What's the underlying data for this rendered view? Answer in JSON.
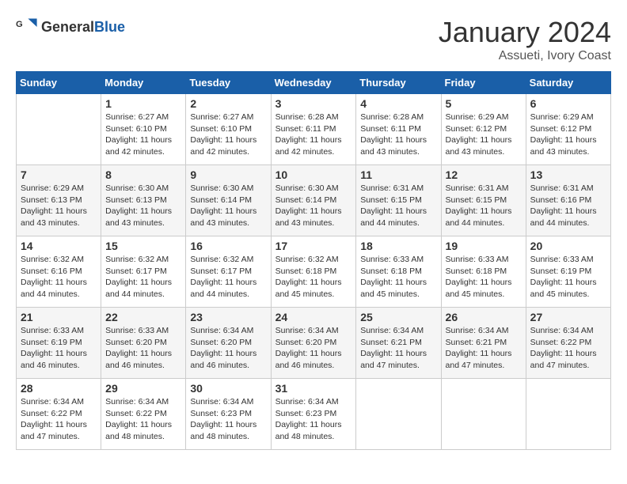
{
  "header": {
    "logo": {
      "general": "General",
      "blue": "Blue"
    },
    "month": "January 2024",
    "location": "Assueti, Ivory Coast"
  },
  "days_of_week": [
    "Sunday",
    "Monday",
    "Tuesday",
    "Wednesday",
    "Thursday",
    "Friday",
    "Saturday"
  ],
  "weeks": [
    [
      {
        "day": "",
        "info": ""
      },
      {
        "day": "1",
        "info": "Sunrise: 6:27 AM\nSunset: 6:10 PM\nDaylight: 11 hours\nand 42 minutes."
      },
      {
        "day": "2",
        "info": "Sunrise: 6:27 AM\nSunset: 6:10 PM\nDaylight: 11 hours\nand 42 minutes."
      },
      {
        "day": "3",
        "info": "Sunrise: 6:28 AM\nSunset: 6:11 PM\nDaylight: 11 hours\nand 42 minutes."
      },
      {
        "day": "4",
        "info": "Sunrise: 6:28 AM\nSunset: 6:11 PM\nDaylight: 11 hours\nand 43 minutes."
      },
      {
        "day": "5",
        "info": "Sunrise: 6:29 AM\nSunset: 6:12 PM\nDaylight: 11 hours\nand 43 minutes."
      },
      {
        "day": "6",
        "info": "Sunrise: 6:29 AM\nSunset: 6:12 PM\nDaylight: 11 hours\nand 43 minutes."
      }
    ],
    [
      {
        "day": "7",
        "info": "Sunrise: 6:29 AM\nSunset: 6:13 PM\nDaylight: 11 hours\nand 43 minutes."
      },
      {
        "day": "8",
        "info": "Sunrise: 6:30 AM\nSunset: 6:13 PM\nDaylight: 11 hours\nand 43 minutes."
      },
      {
        "day": "9",
        "info": "Sunrise: 6:30 AM\nSunset: 6:14 PM\nDaylight: 11 hours\nand 43 minutes."
      },
      {
        "day": "10",
        "info": "Sunrise: 6:30 AM\nSunset: 6:14 PM\nDaylight: 11 hours\nand 43 minutes."
      },
      {
        "day": "11",
        "info": "Sunrise: 6:31 AM\nSunset: 6:15 PM\nDaylight: 11 hours\nand 44 minutes."
      },
      {
        "day": "12",
        "info": "Sunrise: 6:31 AM\nSunset: 6:15 PM\nDaylight: 11 hours\nand 44 minutes."
      },
      {
        "day": "13",
        "info": "Sunrise: 6:31 AM\nSunset: 6:16 PM\nDaylight: 11 hours\nand 44 minutes."
      }
    ],
    [
      {
        "day": "14",
        "info": "Sunrise: 6:32 AM\nSunset: 6:16 PM\nDaylight: 11 hours\nand 44 minutes."
      },
      {
        "day": "15",
        "info": "Sunrise: 6:32 AM\nSunset: 6:17 PM\nDaylight: 11 hours\nand 44 minutes."
      },
      {
        "day": "16",
        "info": "Sunrise: 6:32 AM\nSunset: 6:17 PM\nDaylight: 11 hours\nand 44 minutes."
      },
      {
        "day": "17",
        "info": "Sunrise: 6:32 AM\nSunset: 6:18 PM\nDaylight: 11 hours\nand 45 minutes."
      },
      {
        "day": "18",
        "info": "Sunrise: 6:33 AM\nSunset: 6:18 PM\nDaylight: 11 hours\nand 45 minutes."
      },
      {
        "day": "19",
        "info": "Sunrise: 6:33 AM\nSunset: 6:18 PM\nDaylight: 11 hours\nand 45 minutes."
      },
      {
        "day": "20",
        "info": "Sunrise: 6:33 AM\nSunset: 6:19 PM\nDaylight: 11 hours\nand 45 minutes."
      }
    ],
    [
      {
        "day": "21",
        "info": "Sunrise: 6:33 AM\nSunset: 6:19 PM\nDaylight: 11 hours\nand 46 minutes."
      },
      {
        "day": "22",
        "info": "Sunrise: 6:33 AM\nSunset: 6:20 PM\nDaylight: 11 hours\nand 46 minutes."
      },
      {
        "day": "23",
        "info": "Sunrise: 6:34 AM\nSunset: 6:20 PM\nDaylight: 11 hours\nand 46 minutes."
      },
      {
        "day": "24",
        "info": "Sunrise: 6:34 AM\nSunset: 6:20 PM\nDaylight: 11 hours\nand 46 minutes."
      },
      {
        "day": "25",
        "info": "Sunrise: 6:34 AM\nSunset: 6:21 PM\nDaylight: 11 hours\nand 47 minutes."
      },
      {
        "day": "26",
        "info": "Sunrise: 6:34 AM\nSunset: 6:21 PM\nDaylight: 11 hours\nand 47 minutes."
      },
      {
        "day": "27",
        "info": "Sunrise: 6:34 AM\nSunset: 6:22 PM\nDaylight: 11 hours\nand 47 minutes."
      }
    ],
    [
      {
        "day": "28",
        "info": "Sunrise: 6:34 AM\nSunset: 6:22 PM\nDaylight: 11 hours\nand 47 minutes."
      },
      {
        "day": "29",
        "info": "Sunrise: 6:34 AM\nSunset: 6:22 PM\nDaylight: 11 hours\nand 48 minutes."
      },
      {
        "day": "30",
        "info": "Sunrise: 6:34 AM\nSunset: 6:23 PM\nDaylight: 11 hours\nand 48 minutes."
      },
      {
        "day": "31",
        "info": "Sunrise: 6:34 AM\nSunset: 6:23 PM\nDaylight: 11 hours\nand 48 minutes."
      },
      {
        "day": "",
        "info": ""
      },
      {
        "day": "",
        "info": ""
      },
      {
        "day": "",
        "info": ""
      }
    ]
  ]
}
